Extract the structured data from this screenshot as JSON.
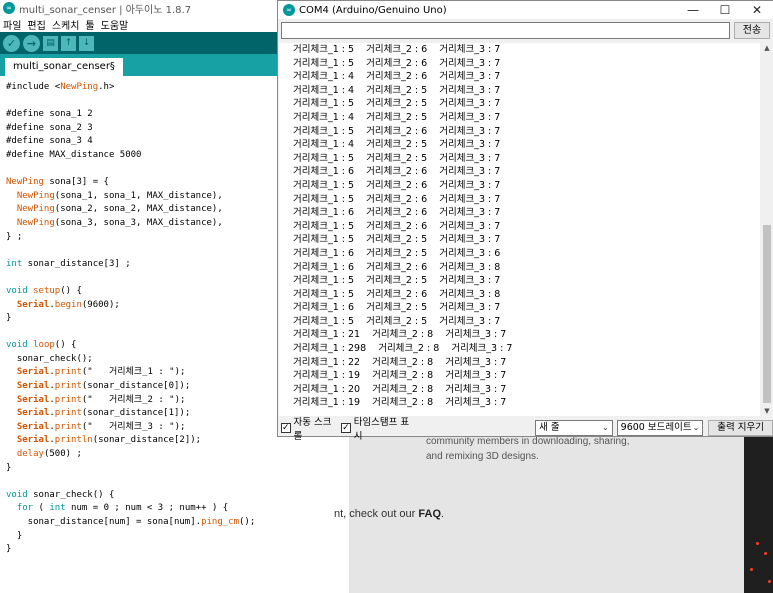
{
  "ide": {
    "title": "multi_sonar_censer | 아두이노 1.8.7",
    "logo": "∞",
    "menu": [
      "파일",
      "편집",
      "스케치",
      "툴",
      "도움말"
    ],
    "toolbar_icons": [
      "verify-icon",
      "upload-icon",
      "new-icon",
      "open-icon",
      "save-icon"
    ],
    "tab": "multi_sonar_censer§",
    "code": [
      "#include <NewPing.h>",
      "",
      "#define sona_1 2",
      "#define sona_2 3",
      "#define sona_3 4",
      "#define MAX_distance 5000",
      "",
      "NewPing sona[3] = {",
      "  NewPing(sona_1, sona_1, MAX_distance),",
      "  NewPing(sona_2, sona_2, MAX_distance),",
      "  NewPing(sona_3, sona_3, MAX_distance),",
      "} ;",
      "",
      "int sonar_distance[3] ;",
      "",
      "void setup() {",
      "  Serial.begin(9600);",
      "}",
      "",
      "void loop() {",
      "  sonar_check();",
      "  Serial.print(\"   거리체크_1 : \");",
      "  Serial.print(sonar_distance[0]);",
      "  Serial.print(\"   거리체크_2 : \");",
      "  Serial.print(sonar_distance[1]);",
      "  Serial.print(\"   거리체크_3 : \");",
      "  Serial.println(sonar_distance[2]);",
      "  delay(500) ;",
      "}",
      "",
      "void sonar_check() {",
      "  for ( int num = 0 ; num < 3 ; num++ ) {",
      "    sonar_distance[num] = sona[num].ping_cm();",
      "  }",
      "}"
    ]
  },
  "serial": {
    "title": "COM4 (Arduino/Genuino Uno)",
    "controls": {
      "minimize": "—",
      "maximize": "☐",
      "close": "✕"
    },
    "input_value": "",
    "send_label": "전송",
    "lines": [
      "거리체크_1 : 5    거리체크_2 : 6    거리체크_3 : 7",
      "거리체크_1 : 5    거리체크_2 : 6    거리체크_3 : 7",
      "거리체크_1 : 4    거리체크_2 : 6    거리체크_3 : 7",
      "거리체크_1 : 4    거리체크_2 : 5    거리체크_3 : 7",
      "거리체크_1 : 5    거리체크_2 : 5    거리체크_3 : 7",
      "거리체크_1 : 4    거리체크_2 : 5    거리체크_3 : 7",
      "거리체크_1 : 5    거리체크_2 : 6    거리체크_3 : 7",
      "거리체크_1 : 4    거리체크_2 : 5    거리체크_3 : 7",
      "거리체크_1 : 5    거리체크_2 : 5    거리체크_3 : 7",
      "거리체크_1 : 6    거리체크_2 : 6    거리체크_3 : 7",
      "거리체크_1 : 5    거리체크_2 : 6    거리체크_3 : 7",
      "거리체크_1 : 5    거리체크_2 : 6    거리체크_3 : 7",
      "거리체크_1 : 6    거리체크_2 : 6    거리체크_3 : 7",
      "거리체크_1 : 5    거리체크_2 : 6    거리체크_3 : 7",
      "거리체크_1 : 5    거리체크_2 : 5    거리체크_3 : 7",
      "거리체크_1 : 6    거리체크_2 : 5    거리체크_3 : 6",
      "거리체크_1 : 6    거리체크_2 : 6    거리체크_3 : 8",
      "거리체크_1 : 5    거리체크_2 : 5    거리체크_3 : 7",
      "거리체크_1 : 5    거리체크_2 : 6    거리체크_3 : 8",
      "거리체크_1 : 6    거리체크_2 : 5    거리체크_3 : 7",
      "거리체크_1 : 5    거리체크_2 : 5    거리체크_3 : 7",
      "거리체크_1 : 21    거리체크_2 : 8    거리체크_3 : 7",
      "거리체크_1 : 298    거리체크_2 : 8    거리체크_3 : 7",
      "거리체크_1 : 22    거리체크_2 : 8    거리체크_3 : 7",
      "거리체크_1 : 19    거리체크_2 : 8    거리체크_3 : 7",
      "거리체크_1 : 20    거리체크_2 : 8    거리체크_3 : 7",
      "거리체크_1 : 19    거리체크_2 : 8    거리체크_3 : 7"
    ],
    "autoscroll_label": "자동 스크롤",
    "autoscroll_checked": true,
    "timestamp_label": "타임스탬프 표시",
    "timestamp_checked": true,
    "line_ending": "새 줄",
    "baud_rate": "9600 보드레이트",
    "clear_label": "출력 지우기"
  },
  "webpage": {
    "line1": "community members in downloading, sharing,",
    "line2": "and remixing 3D designs.",
    "faq_prefix": "nt, check out our ",
    "faq_link": "FAQ",
    "faq_suffix": "."
  }
}
